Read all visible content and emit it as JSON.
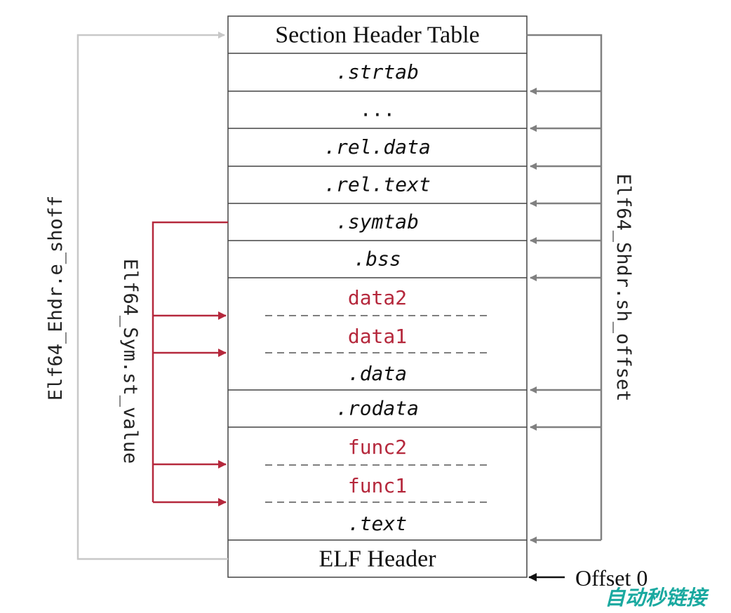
{
  "sections": [
    {
      "label": "Section Header Table",
      "style": "serif"
    },
    {
      "label": ".strtab",
      "style": "mono-italic"
    },
    {
      "label": "...",
      "style": "mono"
    },
    {
      "label": ".rel.data",
      "style": "mono-italic"
    },
    {
      "label": ".rel.text",
      "style": "mono-italic"
    },
    {
      "label": ".symtab",
      "style": "mono-italic"
    },
    {
      "label": ".bss",
      "style": "mono-italic"
    },
    {
      "label": ".data",
      "style": "mono-italic",
      "symbols": [
        "data2",
        "data1"
      ]
    },
    {
      "label": ".rodata",
      "style": "mono-italic"
    },
    {
      "label": ".text",
      "style": "mono-italic",
      "symbols": [
        "func2",
        "func1"
      ]
    },
    {
      "label": "ELF Header",
      "style": "serif"
    }
  ],
  "labels": {
    "left": "Elf64_Ehdr.e_shoff",
    "right": "Elf64_Shdr.sh_offset",
    "symbols": "Elf64_Sym.st_value",
    "offset": "Offset 0"
  },
  "watermark": "自动秒链接",
  "colors": {
    "border": "#444444",
    "right_arrows": "#808080",
    "left_arrow": "#c8c8c8",
    "symbol_red": "#b5283c",
    "watermark": "#1aa9a0"
  }
}
